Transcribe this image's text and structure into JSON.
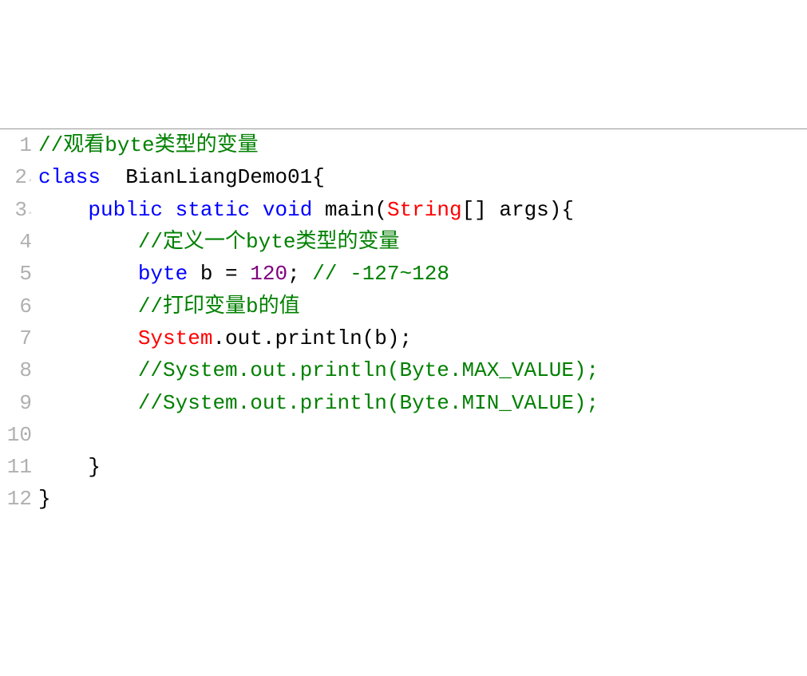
{
  "lines": [
    {
      "num": "1",
      "fold": "",
      "segments": [
        {
          "cls": "comment",
          "text": "//观看byte类型的变量"
        }
      ]
    },
    {
      "num": "2",
      "fold": "▫",
      "segments": [
        {
          "cls": "keyword",
          "text": "class"
        },
        {
          "cls": "text",
          "text": "  BianLiangDemo01{"
        }
      ]
    },
    {
      "num": "3",
      "fold": "▫",
      "segments": [
        {
          "cls": "text",
          "text": "    "
        },
        {
          "cls": "keyword",
          "text": "public"
        },
        {
          "cls": "text",
          "text": " "
        },
        {
          "cls": "keyword",
          "text": "static"
        },
        {
          "cls": "text",
          "text": " "
        },
        {
          "cls": "keyword",
          "text": "void"
        },
        {
          "cls": "text",
          "text": " main("
        },
        {
          "cls": "string-type",
          "text": "String"
        },
        {
          "cls": "text",
          "text": "[] args){"
        }
      ]
    },
    {
      "num": "4",
      "fold": "",
      "segments": [
        {
          "cls": "text",
          "text": "        "
        },
        {
          "cls": "comment",
          "text": "//定义一个byte类型的变量"
        }
      ]
    },
    {
      "num": "5",
      "fold": "",
      "segments": [
        {
          "cls": "text",
          "text": "        "
        },
        {
          "cls": "keyword",
          "text": "byte"
        },
        {
          "cls": "text",
          "text": " b = "
        },
        {
          "cls": "number",
          "text": "120"
        },
        {
          "cls": "text",
          "text": "; "
        },
        {
          "cls": "comment",
          "text": "// -127~128"
        }
      ]
    },
    {
      "num": "6",
      "fold": "",
      "segments": [
        {
          "cls": "text",
          "text": "        "
        },
        {
          "cls": "comment",
          "text": "//打印变量b的值"
        }
      ]
    },
    {
      "num": "7",
      "fold": "",
      "segments": [
        {
          "cls": "text",
          "text": "        "
        },
        {
          "cls": "system",
          "text": "System"
        },
        {
          "cls": "text",
          "text": ".out.println(b);"
        }
      ]
    },
    {
      "num": "8",
      "fold": "",
      "segments": [
        {
          "cls": "text",
          "text": "        "
        },
        {
          "cls": "comment",
          "text": "//System.out.println(Byte.MAX_VALUE);"
        }
      ]
    },
    {
      "num": "9",
      "fold": "",
      "segments": [
        {
          "cls": "text",
          "text": "        "
        },
        {
          "cls": "comment",
          "text": "//System.out.println(Byte.MIN_VALUE);"
        }
      ]
    },
    {
      "num": "10",
      "fold": "",
      "segments": [
        {
          "cls": "text",
          "text": ""
        }
      ]
    },
    {
      "num": "11",
      "fold": "",
      "segments": [
        {
          "cls": "text",
          "text": "    }"
        }
      ]
    },
    {
      "num": "12",
      "fold": "",
      "segments": [
        {
          "cls": "text",
          "text": "}"
        }
      ]
    }
  ]
}
